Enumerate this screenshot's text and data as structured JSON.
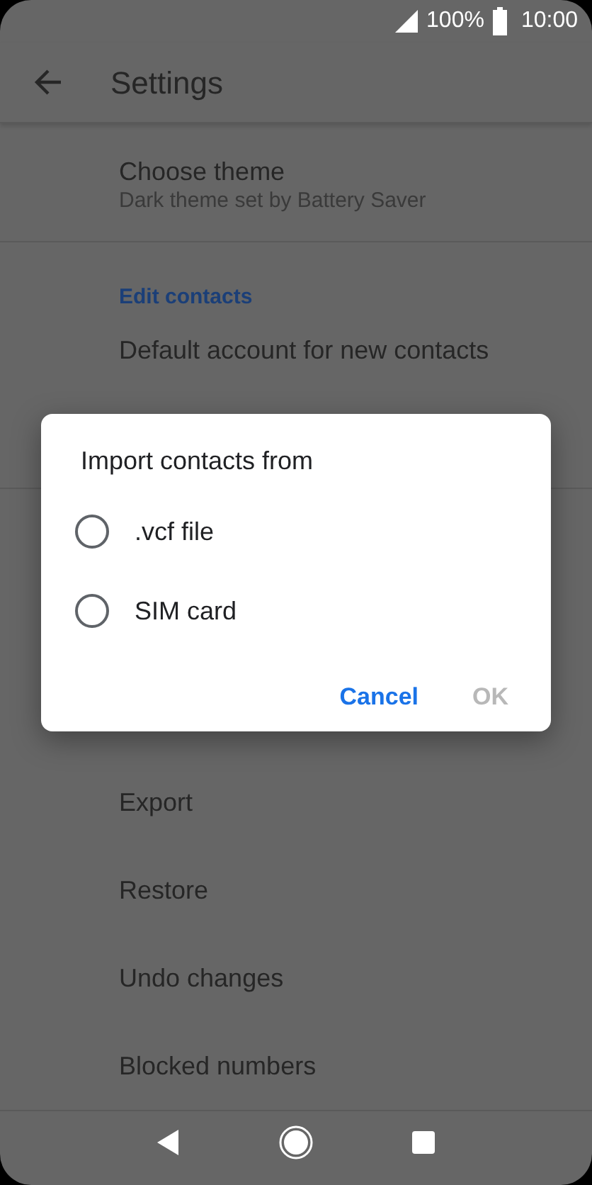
{
  "status_bar": {
    "battery": "100%",
    "time": "10:00"
  },
  "toolbar": {
    "title": "Settings"
  },
  "settings": [
    {
      "kind": "item",
      "title": "Choose theme",
      "subtitle": "Dark theme set by Battery Saver"
    },
    {
      "kind": "header",
      "title": "Edit contacts"
    },
    {
      "kind": "item",
      "title": "Default account for new contacts"
    },
    {
      "kind": "spacer"
    },
    {
      "kind": "item",
      "title": "Export"
    },
    {
      "kind": "item",
      "title": "Restore"
    },
    {
      "kind": "item",
      "title": "Undo changes"
    },
    {
      "kind": "item",
      "title": "Blocked numbers"
    }
  ],
  "dialog": {
    "title": "Import contacts from",
    "options": [
      {
        "label": ".vcf file",
        "selected": false
      },
      {
        "label": "SIM card",
        "selected": false
      }
    ],
    "buttons": [
      {
        "label": "Cancel",
        "disabled": false
      },
      {
        "label": "OK",
        "disabled": true
      }
    ]
  }
}
